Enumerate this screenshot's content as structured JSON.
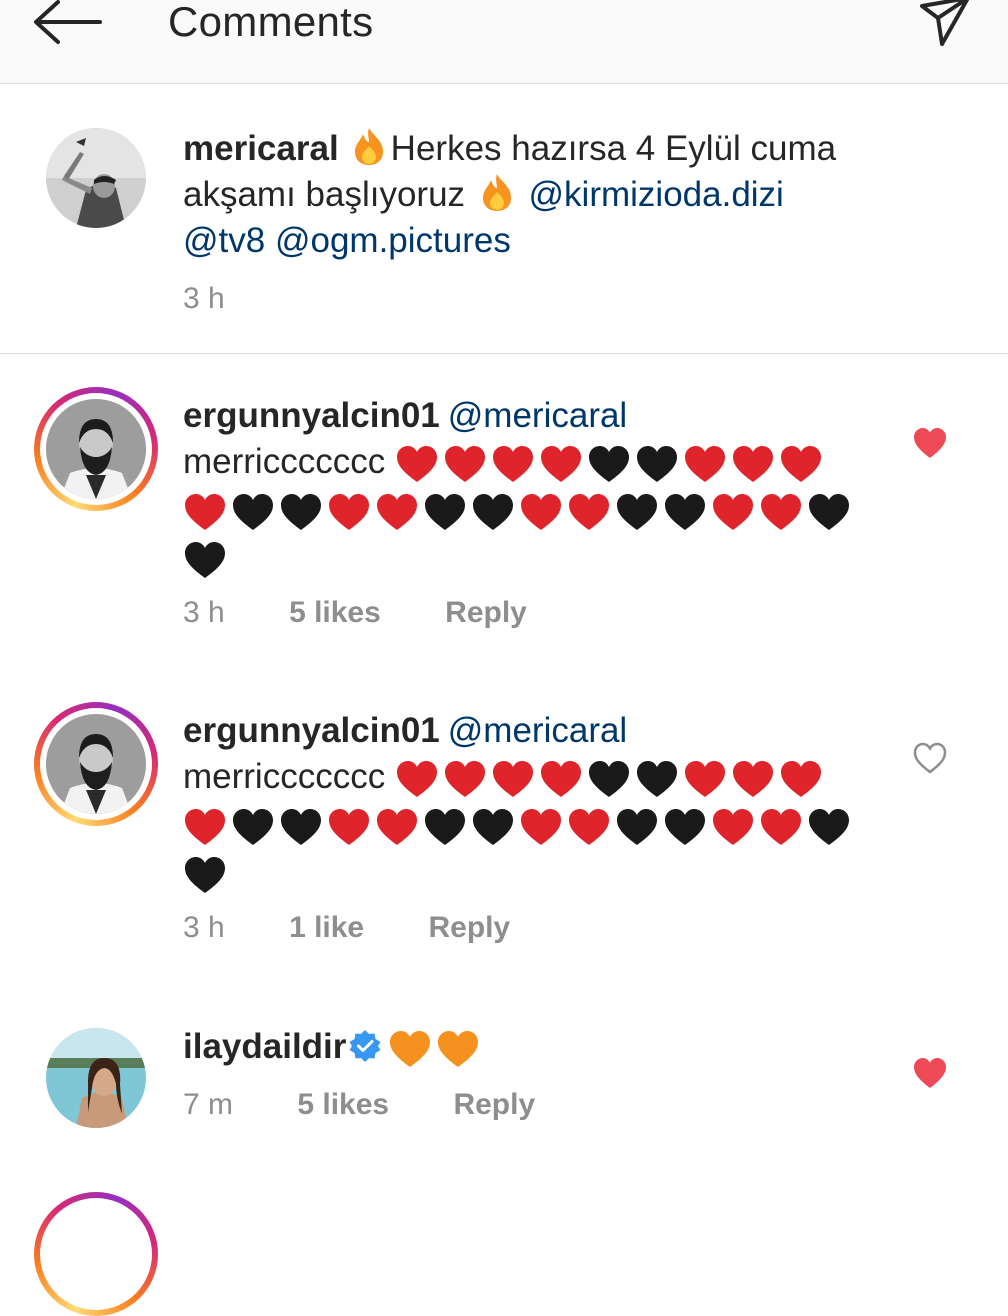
{
  "header": {
    "title": "Comments",
    "back_icon": "arrow-left-icon",
    "send_icon": "direct-send-icon"
  },
  "caption": {
    "username": "mericaral",
    "text_1": "Herkes hazırsa 4 Eylül cuma",
    "text_2": "akşamı başlıyoruz",
    "mention_1": "@kirmizioda.dizi",
    "mention_2": "@tv8",
    "mention_3": "@ogm.pictures",
    "time": "3 h"
  },
  "comments": [
    {
      "username": "ergunnyalcin01",
      "mention": "@mericaral",
      "text": "merriccccccc",
      "hearts_line1": [
        "red",
        "red",
        "red",
        "red",
        "black",
        "black",
        "red",
        "red",
        "red"
      ],
      "hearts_line2": [
        "red",
        "black",
        "black",
        "red",
        "red",
        "black",
        "black",
        "red",
        "red",
        "black",
        "black",
        "red",
        "red",
        "black"
      ],
      "hearts_line3": [
        "black"
      ],
      "time": "3 h",
      "likes": "5 likes",
      "reply": "Reply",
      "liked": true
    },
    {
      "username": "ergunnyalcin01",
      "mention": "@mericaral",
      "text": "merriccccccc",
      "hearts_line1": [
        "red",
        "red",
        "red",
        "red",
        "black",
        "black",
        "red",
        "red",
        "red"
      ],
      "hearts_line2": [
        "red",
        "black",
        "black",
        "red",
        "red",
        "black",
        "black",
        "red",
        "red",
        "black",
        "black",
        "red",
        "red",
        "black"
      ],
      "hearts_line3": [
        "black"
      ],
      "time": "3 h",
      "likes": "1 like",
      "reply": "Reply",
      "liked": false
    },
    {
      "username": "ilaydaildir",
      "verified": true,
      "hearts": [
        "orange",
        "orange"
      ],
      "time": "7 m",
      "likes": "5 likes",
      "reply": "Reply",
      "liked": true
    }
  ],
  "colors": {
    "heart_red": "#e0242c",
    "heart_black": "#1a1a1a",
    "heart_orange": "#f5911e",
    "like_red": "#ed4956",
    "mention_blue": "#00376b",
    "verified_blue": "#3897f0",
    "meta_gray": "#8e8e8e"
  }
}
